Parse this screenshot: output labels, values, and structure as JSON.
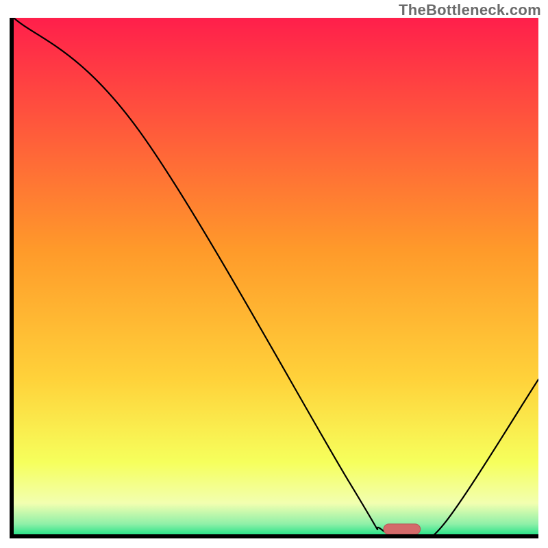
{
  "watermark": "TheBottleneck.com",
  "colors": {
    "gradient_top": "#ff1f4b",
    "gradient_mid1": "#ff7a2a",
    "gradient_mid2": "#ffd23a",
    "gradient_mid3": "#f6ff5c",
    "gradient_bottom_yellow": "#f2ffb0",
    "gradient_green": "#2de38a",
    "axis": "#000000",
    "line": "#000000",
    "marker_fill": "#d46a6a",
    "marker_stroke": "#b85a5a"
  },
  "chart_data": {
    "type": "line",
    "title": "",
    "xlabel": "",
    "ylabel": "",
    "xlim": [
      0,
      100
    ],
    "ylim": [
      0,
      100
    ],
    "x": [
      0,
      24,
      64,
      70,
      76,
      82,
      100
    ],
    "values": [
      100,
      78,
      10,
      1,
      0,
      2,
      30
    ],
    "marker": {
      "x": 74,
      "y": 1,
      "width": 7,
      "height": 2
    },
    "annotations": []
  }
}
